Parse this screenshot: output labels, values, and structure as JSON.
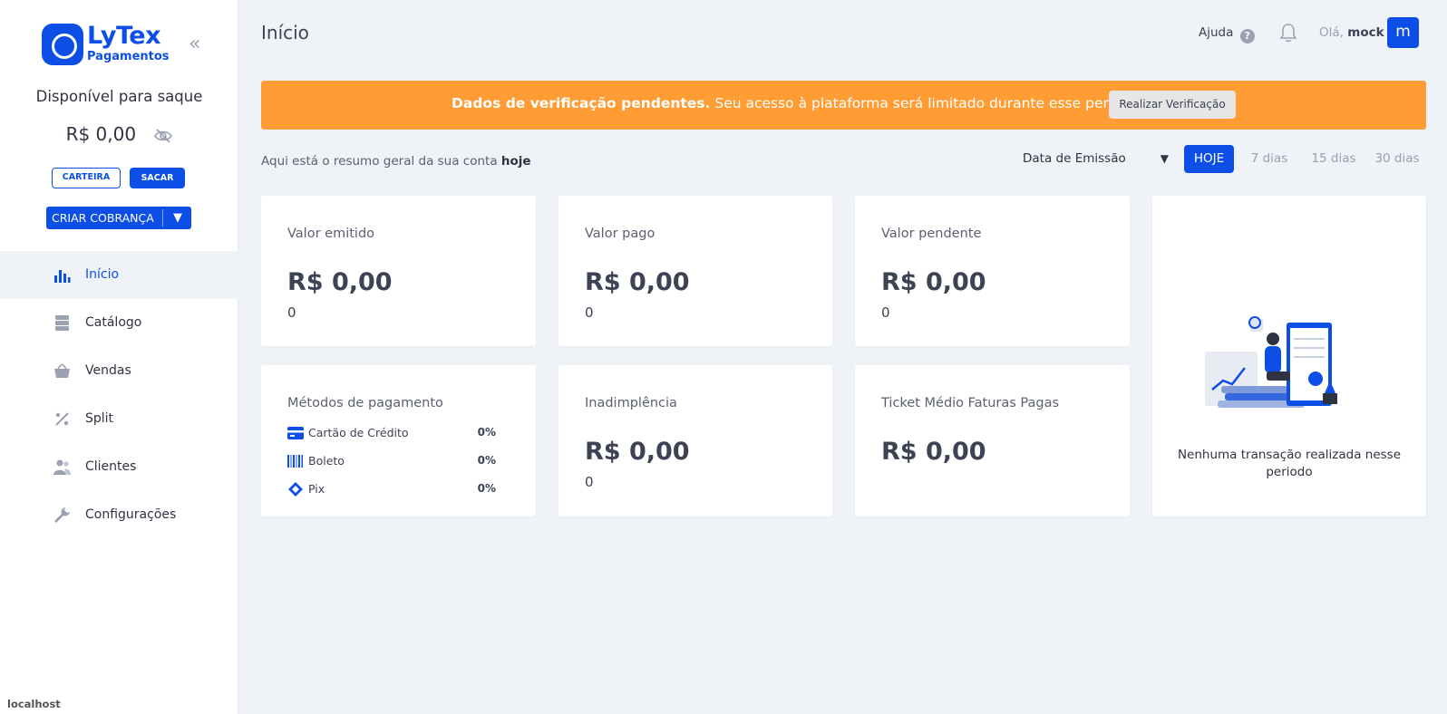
{
  "brand": {
    "name": "LyTex",
    "sub": "Pagamentos",
    "accent": "#0d4fe6"
  },
  "sidebar": {
    "balance_title": "Disponível para saque",
    "balance_value": "R$ 0,00",
    "wallet_label": "CARTEIRA",
    "withdraw_label": "SACAR",
    "create_label": "CRIAR COBRANÇA",
    "items": [
      {
        "label": "Início",
        "icon": "bar-chart-icon"
      },
      {
        "label": "Catálogo",
        "icon": "catalog-icon"
      },
      {
        "label": "Vendas",
        "icon": "basket-icon"
      },
      {
        "label": "Split",
        "icon": "split-icon"
      },
      {
        "label": "Clientes",
        "icon": "people-icon"
      },
      {
        "label": "Configurações",
        "icon": "wrench-icon"
      }
    ],
    "footer": "localhost"
  },
  "header": {
    "title": "Início",
    "help": "Ajuda",
    "greeting": "Olá,",
    "user": "mock",
    "avatar_letter": "m"
  },
  "alert": {
    "bold": "Dados de verificação pendentes.",
    "text": " Seu acesso à plataforma será limitado durante esse período.",
    "button": "Realizar Verificação",
    "color": "#ff9c33"
  },
  "summary": {
    "text": "Aqui está o resumo geral da sua conta ",
    "highlight": "hoje",
    "date_filter": "Data de Emissão",
    "ranges": [
      "HOJE",
      "7 dias",
      "15 dias",
      "30 dias"
    ]
  },
  "cards": {
    "emitido": {
      "label": "Valor emitido",
      "value": "R$ 0,00",
      "count": "0"
    },
    "pago": {
      "label": "Valor pago",
      "value": "R$ 0,00",
      "count": "0"
    },
    "pendente": {
      "label": "Valor pendente",
      "value": "R$ 0,00",
      "count": "0"
    },
    "metodos": {
      "label": "Métodos de pagamento",
      "items": [
        {
          "label": "Cartão de Crédito",
          "pct": "0%"
        },
        {
          "label": "Boleto",
          "pct": "0%"
        },
        {
          "label": "Pix",
          "pct": "0%"
        }
      ]
    },
    "inadimplencia": {
      "label": "Inadimplência",
      "value": "R$ 0,00",
      "count": "0"
    },
    "ticket": {
      "label": "Ticket Médio Faturas Pagas",
      "value": "R$ 0,00"
    },
    "empty": {
      "text": "Nenhuma transação realizada nesse periodo"
    }
  }
}
